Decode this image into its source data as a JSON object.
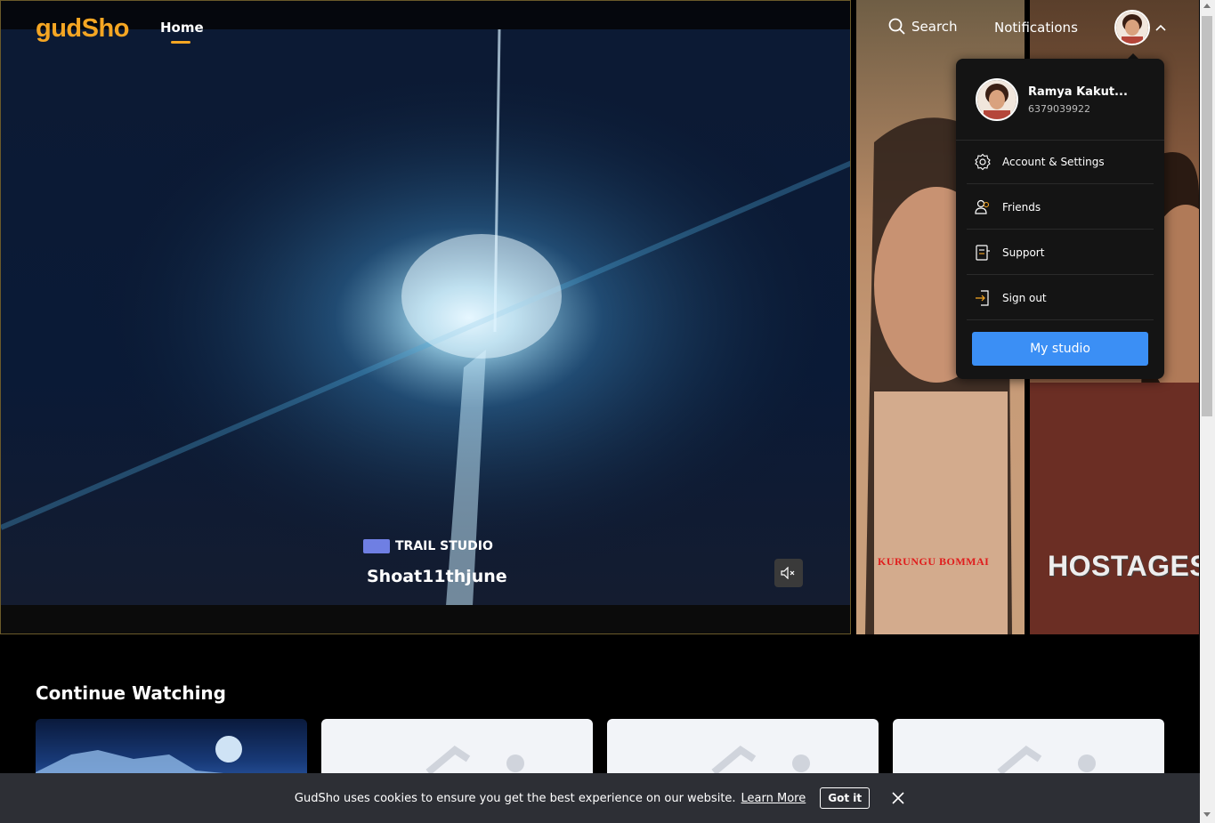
{
  "brand": {
    "logo": "gudSho",
    "accent": "#f5a623"
  },
  "nav": {
    "home": "Home",
    "search": "Search",
    "notifications": "Notifications"
  },
  "hero": {
    "studio": "TRAIL STUDIO",
    "title": "Shoat11thjune"
  },
  "posters": [
    {
      "title": "KURUNGU BOMMAI"
    },
    {
      "title": "HOSTAGES"
    }
  ],
  "profile_menu": {
    "name": "Ramya Kakut...",
    "phone": "6379039922",
    "items": [
      {
        "label": "Account & Settings",
        "icon": "gear-icon"
      },
      {
        "label": "Friends",
        "icon": "friends-icon"
      },
      {
        "label": "Support",
        "icon": "support-icon"
      },
      {
        "label": "Sign out",
        "icon": "sign-out-icon"
      }
    ],
    "studio_button": "My studio"
  },
  "continue_watching": {
    "title": "Continue Watching"
  },
  "cookie": {
    "text": "GudSho uses cookies to ensure you get the best experience on our website.",
    "link": "Learn More",
    "accept": "Got it"
  },
  "colors": {
    "primary_button": "#3b8ff5",
    "dropdown_bg": "#141414",
    "cookie_bg": "#2d2f35"
  }
}
